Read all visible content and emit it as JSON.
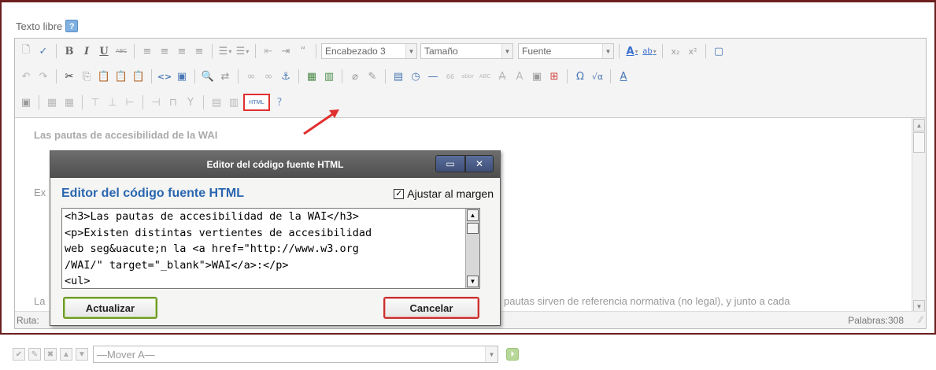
{
  "field": {
    "label": "Texto libre",
    "help_icon": "?"
  },
  "toolbar": {
    "row1": {
      "new_doc": "🗋",
      "spellcheck": "✓",
      "bold": "B",
      "italic": "I",
      "underline": "U",
      "strike": "ABC",
      "align_left": "≡",
      "align_center": "≡",
      "align_right": "≡",
      "align_justify": "≡",
      "ul": "☰",
      "ol": "☰",
      "outdent": "⇤",
      "indent": "⇥",
      "blockquote": "“",
      "format_value": "Encabezado 3",
      "size_value": "Tamaño",
      "font_value": "Fuente",
      "text_color": "A",
      "highlight": "ab",
      "subscript": "x₂",
      "superscript": "x²",
      "fullscreen": "▢"
    },
    "row2": {
      "undo": "↶",
      "redo": "↷",
      "cut": "✂",
      "copy": "⎘",
      "paste": "📋",
      "paste_text": "📋",
      "paste_word": "📋",
      "code": "<>",
      "media": "▣",
      "find": "🔍",
      "replace": "⇄",
      "link": "∞",
      "unlink": "∞",
      "anchor": "⚓",
      "image": "▦",
      "embed": "▥",
      "clean": "⌀",
      "brush": "✎",
      "date": "▤",
      "time": "◷",
      "hr": "—",
      "cite": "66",
      "abbr": "abbr",
      "acronym": "ABC",
      "del": "A",
      "ins": "A",
      "attribs": "▣",
      "nbsp": "⊞",
      "omega": "Ω",
      "math": "√α",
      "spell": "A"
    },
    "row3": {
      "html_label": "HTML",
      "help": "?"
    }
  },
  "editor": {
    "line1": "Las pautas de accesibilidad de la WAI",
    "line2_prefix": "Ex",
    "line3_prefix": "La",
    "line3_suffix": "pautas sirven de referencia normativa (no legal), y junto a cada",
    "status_path_label": "Ruta:",
    "word_count": "Palabras:308"
  },
  "dialog": {
    "title": "Editor del código fuente HTML",
    "heading": "Editor del código fuente HTML",
    "wrap_label": "Ajustar al margen",
    "wrap_checked": true,
    "code": "<h3>Las pautas de accesibilidad de la WAI</h3>\n<p>Existen distintas vertientes de accesibilidad\nweb seg&uacute;n la <a href=\"http://www.w3.org\n/WAI/\" target=\"_blank\">WAI</a>:</p>\n<ul>",
    "update_label": "Actualizar",
    "cancel_label": "Cancelar"
  },
  "bottom": {
    "move_placeholder": "—Mover A—"
  },
  "colors": {
    "frame": "#6b1f1f",
    "highlight": "#e03030",
    "heading": "#2a66b0",
    "ok_border": "#6f9a26",
    "cancel_border": "#c8302f"
  }
}
